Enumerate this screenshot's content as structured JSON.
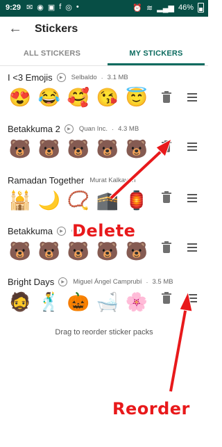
{
  "status_bar": {
    "time": "9:29",
    "left_icons": [
      "notification-icon",
      "notification-icon",
      "notification-icon",
      "notification-icon",
      "notification-icon",
      "notification-icon"
    ],
    "battery": "46%"
  },
  "app_bar": {
    "title": "Stickers"
  },
  "tabs": [
    {
      "label": "ALL STICKERS",
      "active": false
    },
    {
      "label": "MY STICKERS",
      "active": true
    }
  ],
  "packs": [
    {
      "name": "I <3 Emojis",
      "author": "Selbaldo",
      "size": "3.1 MB",
      "stickers": [
        "😍",
        "😂",
        "🥰",
        "😘",
        "😇",
        "🦊"
      ]
    },
    {
      "name": "Betakkuma 2",
      "author": "Quan Inc.",
      "size": "4.3 MB",
      "stickers": [
        "🐻",
        "🐻",
        "🐻",
        "🐻",
        "🐻",
        "🐻"
      ]
    },
    {
      "name": "Ramadan Together",
      "author": "Murat Kalkavan",
      "size": "",
      "stickers": [
        "🕌",
        "🌙",
        "📿",
        "🕋",
        "🏮",
        "🤲"
      ]
    },
    {
      "name": "Betakkuma",
      "author": "Qua",
      "size": "",
      "stickers": [
        "🐻",
        "🐻",
        "🐻",
        "🐻",
        "🐻",
        "🐻"
      ]
    },
    {
      "name": "Bright Days",
      "author": "Miguel Ángel Camprubí",
      "size": "3.5 MB",
      "stickers": [
        "🧔",
        "🕺",
        "🎃",
        "🛁",
        "🌸",
        "🐰"
      ]
    }
  ],
  "footer_hint": "Drag to reorder sticker packs",
  "annotations": {
    "delete": "Delete",
    "reorder": "Reorder"
  },
  "colors": {
    "header": "#074e45",
    "accent": "#0c6b5f",
    "annotation": "#e8191b"
  }
}
